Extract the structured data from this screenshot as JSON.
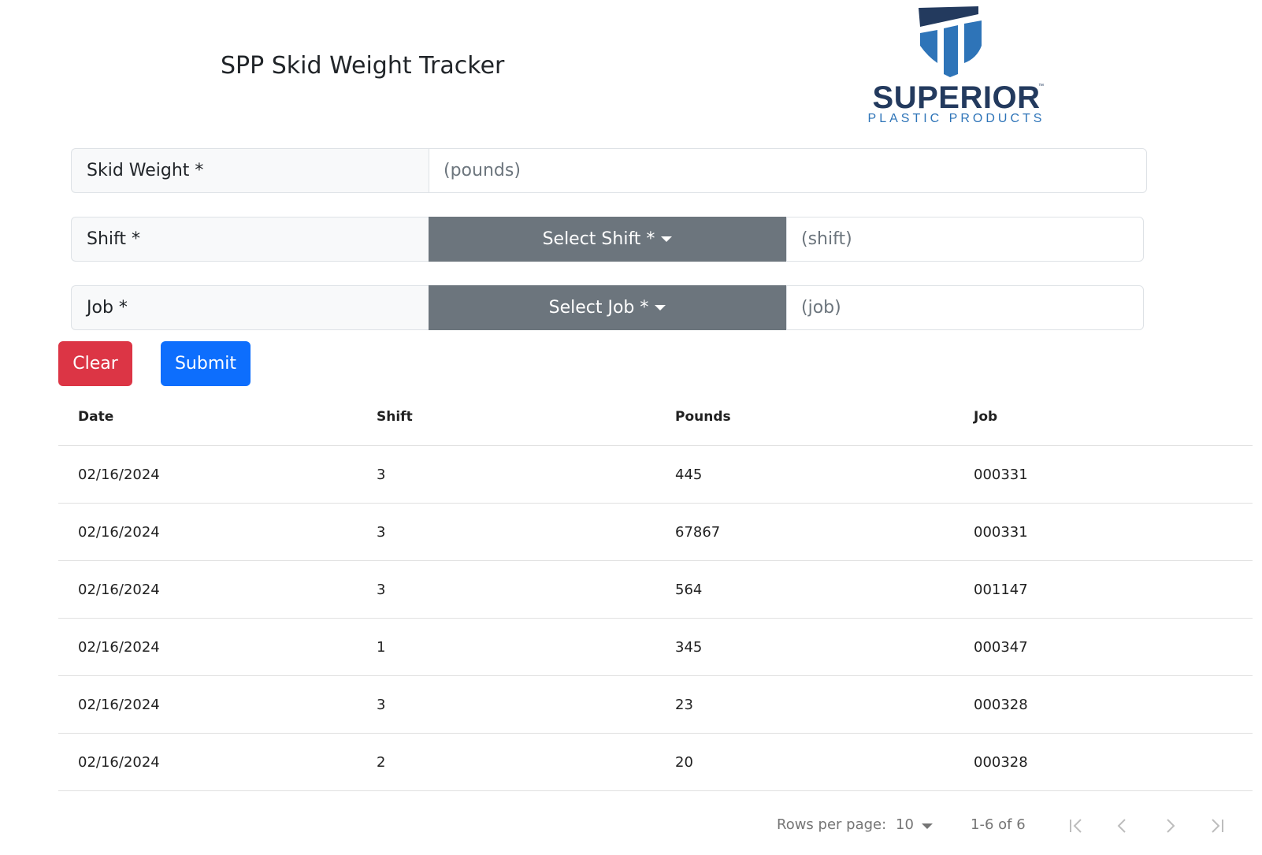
{
  "header": {
    "title": "SPP Skid Weight Tracker",
    "logo": {
      "brand": "SUPERIOR",
      "trademark": "™",
      "subtitle": "PLASTIC PRODUCTS"
    }
  },
  "form": {
    "skid_weight": {
      "label": "Skid Weight *",
      "placeholder": "(pounds)",
      "value": ""
    },
    "shift": {
      "label": "Shift *",
      "dropdown_label": "Select Shift *",
      "display": "(shift)"
    },
    "job": {
      "label": "Job *",
      "dropdown_label": "Select Job *",
      "display": "(job)"
    }
  },
  "buttons": {
    "clear": "Clear",
    "submit": "Submit"
  },
  "table": {
    "columns": [
      "Date",
      "Shift",
      "Pounds",
      "Job"
    ],
    "rows": [
      [
        "02/16/2024",
        "3",
        "445",
        "000331"
      ],
      [
        "02/16/2024",
        "3",
        "67867",
        "000331"
      ],
      [
        "02/16/2024",
        "3",
        "564",
        "001147"
      ],
      [
        "02/16/2024",
        "1",
        "345",
        "000347"
      ],
      [
        "02/16/2024",
        "3",
        "23",
        "000328"
      ],
      [
        "02/16/2024",
        "2",
        "20",
        "000328"
      ]
    ]
  },
  "pagination": {
    "rows_per_page_label": "Rows per page:",
    "rows_per_page_value": "10",
    "range": "1-6 of 6",
    "icons": [
      "first-page-icon",
      "previous-page-icon",
      "next-page-icon",
      "last-page-icon"
    ]
  },
  "colors": {
    "danger": "#dc3545",
    "primary": "#0d6efd",
    "secondary": "#6c757d",
    "logo_navy": "#233a5e",
    "logo_blue": "#2e74b8"
  }
}
